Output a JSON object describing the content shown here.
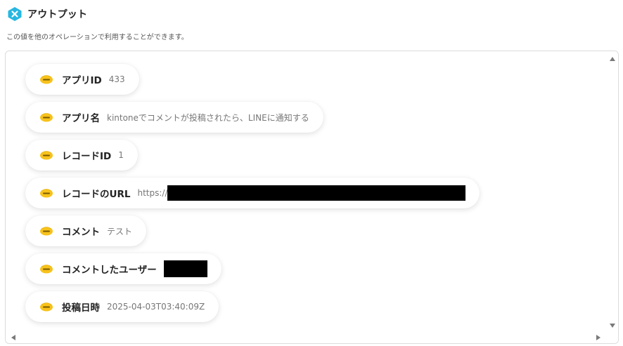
{
  "header": {
    "title": "アウトプット",
    "description": "この値を他のオペレーションで利用することができます。"
  },
  "colors": {
    "brand_hex": "#27b7e1",
    "kintone_yellow": "#f7c21c"
  },
  "outputs": [
    {
      "label": "アプリID",
      "value": "433",
      "icon": "kintone-icon"
    },
    {
      "label": "アプリ名",
      "value": "kintoneでコメントが投稿されたら、LINEに通知する",
      "icon": "kintone-icon"
    },
    {
      "label": "レコードID",
      "value": "1",
      "icon": "kintone-icon"
    },
    {
      "label": "レコードのURL",
      "value": "https://",
      "icon": "kintone-icon",
      "redacted": true
    },
    {
      "label": "コメント",
      "value": "テスト",
      "icon": "kintone-icon"
    },
    {
      "label": "コメントしたユーザー",
      "value": "",
      "icon": "kintone-icon",
      "redacted": true
    },
    {
      "label": "投稿日時",
      "value": "2025-04-03T03:40:09Z",
      "icon": "kintone-icon"
    }
  ]
}
